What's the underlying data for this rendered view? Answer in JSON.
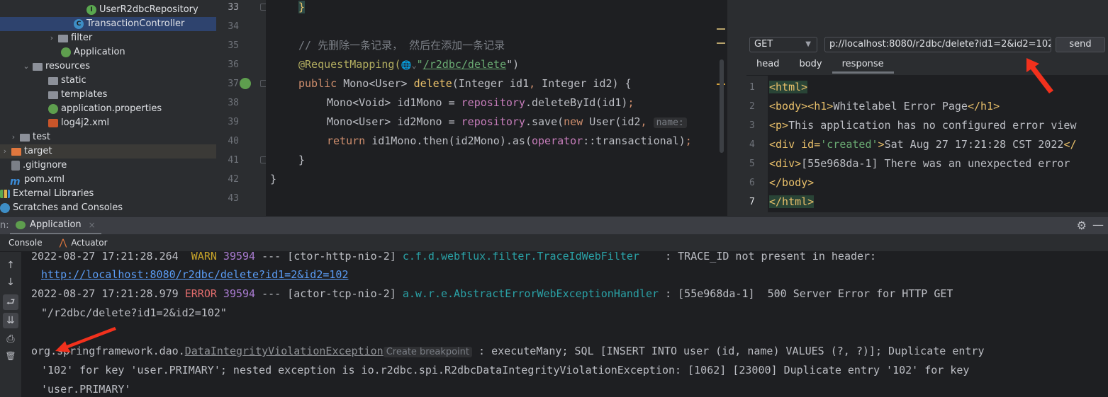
{
  "project_tree": {
    "items": [
      {
        "label": "UserR2dbcRepository",
        "icon": "interface-icon"
      },
      {
        "label": "TransactionController",
        "icon": "class-icon",
        "selected": true
      },
      {
        "label": "filter",
        "icon": "package-folder-icon",
        "collapsed": true
      },
      {
        "label": "Application",
        "icon": "spring-app-icon"
      },
      {
        "label": "resources",
        "icon": "resources-folder-icon",
        "expanded": true
      },
      {
        "label": "static",
        "icon": "folder-icon"
      },
      {
        "label": "templates",
        "icon": "folder-icon"
      },
      {
        "label": "application.properties",
        "icon": "spring-properties-icon"
      },
      {
        "label": "log4j2.xml",
        "icon": "xml-file-icon"
      },
      {
        "label": "test",
        "icon": "folder-icon",
        "collapsed": true
      },
      {
        "label": "target",
        "icon": "excluded-folder-icon",
        "collapsed": true
      },
      {
        "label": ".gitignore",
        "icon": "gitignore-file-icon"
      },
      {
        "label": "pom.xml",
        "icon": "maven-icon"
      },
      {
        "label": "External Libraries",
        "icon": "libraries-icon"
      },
      {
        "label": "Scratches and Consoles",
        "icon": "scratches-icon"
      }
    ]
  },
  "editor": {
    "line_numbers": [
      "33",
      "34",
      "35",
      "36",
      "37",
      "38",
      "39",
      "40",
      "41",
      "42",
      "43"
    ],
    "lines": {
      "l33": "}",
      "l35": "// 先删除一条记录， 然后在添加一条记录",
      "l36_ann": "@RequestMapping(",
      "l36_globe": "🌐⌄",
      "l36_str_q": "\"",
      "l36_path": "/r2dbc/delete",
      "l36_end": "\")",
      "l37_kw": "public",
      "l37_type": " Mono<User> ",
      "l37_fn": "delete",
      "l37_params": "(Integer id1",
      "l37_comma": ",",
      "l37_rest": " Integer id2) {",
      "l38_a": "Mono<Void> id1Mono = ",
      "l38_field": "repository",
      "l38_b": ".deleteById(id1)",
      "l38_semi": ";",
      "l39_a": "Mono<User> id2Mono = ",
      "l39_field": "repository",
      "l39_b": ".save(",
      "l39_kw": "new",
      "l39_c": " User(id2",
      "l39_comma": ",",
      "l39_hint": "name:",
      "l40_kw": "return",
      "l40_a": " id1Mono.then(id2Mono).as(",
      "l40_field": "operator",
      "l40_b": "::transactional)",
      "l40_semi": ";",
      "l41": "}",
      "l42": "}"
    }
  },
  "http_client": {
    "method": "GET",
    "url": "p://localhost:8080/r2dbc/delete?id1=2&id2=102",
    "send_label": "send",
    "tabs": [
      {
        "label": "head"
      },
      {
        "label": "body"
      },
      {
        "label": "response",
        "active": true
      }
    ],
    "response_line_numbers": [
      "1",
      "2",
      "3",
      "4",
      "5",
      "6",
      "7"
    ],
    "response": {
      "r1": "<html>",
      "r2_a": "<body><h1>",
      "r2_b": "Whitelabel Error Page",
      "r2_c": "</h1>",
      "r3_a": "<p>",
      "r3_b": "This application has no configured error view",
      "r4_a": "<div id=",
      "r4_b": "'created'",
      "r4_c": ">",
      "r4_d": "Sat Aug 27 17:21:28 CST 2022",
      "r4_e": "</",
      "r5_a": "<div>",
      "r5_b": "[55e968da-1] There was an unexpected error",
      "r6": "</body>",
      "r7": "</html>"
    }
  },
  "run_window": {
    "label_prefix": "n:",
    "tab_label": "Application",
    "close_glyph": "×",
    "gear_glyph": "⚙",
    "minimize_glyph": "—",
    "subtabs": [
      {
        "label": "Console"
      },
      {
        "label": "Actuator"
      }
    ],
    "tool_glyphs": {
      "up": "↑",
      "down": "↓",
      "wrap": "⮐",
      "scroll_end": "⇊",
      "print": "⎙",
      "clear": "🗑"
    }
  },
  "console": {
    "l1_ts": "2022-08-27 17:21:28.264  ",
    "l1_level": "WARN",
    "l1_pid": " 39594",
    "l1_thread": " --- [ctor-http-nio-2] ",
    "l1_logger": "c.f.d.webflux.filter.TraceIdWebFilter",
    "l1_msg": "    : TRACE_ID not present in header: ",
    "l2_link": "http://localhost:8080/r2dbc/delete?id1=2&id2=102",
    "l3_ts": "2022-08-27 17:21:28.979 ",
    "l3_level": "ERROR",
    "l3_pid": " 39594",
    "l3_thread": " --- [actor-tcp-nio-2] ",
    "l3_logger": "a.w.r.e.AbstractErrorWebExceptionHandler",
    "l3_msg": " : [55e968da-1]  500 Server Error for HTTP GET",
    "l4": "\"/r2dbc/delete?id1=2&id2=102\"",
    "l6_pkg": "org.springframework.dao.",
    "l6_exc": "DataIntegrityViolationException",
    "l6_bp": "Create breakpoint",
    "l6_msg": " : executeMany; SQL [INSERT INTO user (id, name) VALUES (?, ?)]; Duplicate entry",
    "l7": "'102' for key 'user.PRIMARY'; nested exception is io.r2dbc.spi.R2dbcDataIntegrityViolationException: [1062] [23000] Duplicate entry '102' for key",
    "l8": "'user.PRIMARY'"
  },
  "colors": {
    "accent_selection": "#2e436e",
    "annotation_arrow": "#f2311d",
    "error": "#e06c6c",
    "warn": "#c7a42a",
    "logger": "#2aa1a6"
  }
}
